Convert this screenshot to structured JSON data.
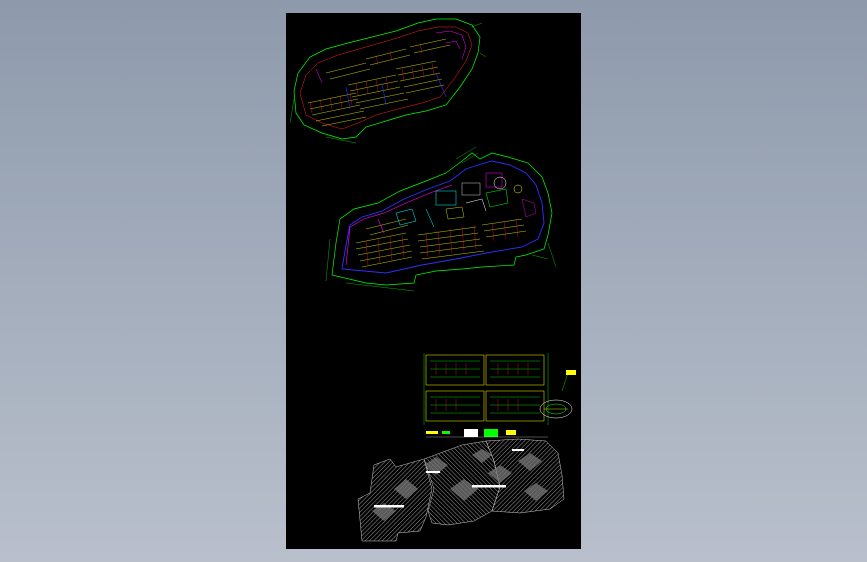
{
  "workspace": {
    "background_top": "#8e99ab",
    "background_bottom": "#b9c0cc"
  },
  "sheet": {
    "background": "#000000"
  },
  "drawings": {
    "top_plan": {
      "name": "top-site-plan"
    },
    "middle_plan": {
      "name": "middle-site-plan"
    },
    "detail_plan": {
      "name": "detail-plan"
    },
    "hatch_plan": {
      "name": "hatch-plan"
    }
  },
  "colors": {
    "green": "#00ff00",
    "yellow": "#ffff00",
    "red": "#ff2020",
    "magenta": "#ff00ff",
    "blue": "#3030ff",
    "cyan": "#00ffff",
    "white": "#ffffff",
    "gray": "#9a9a9a"
  }
}
